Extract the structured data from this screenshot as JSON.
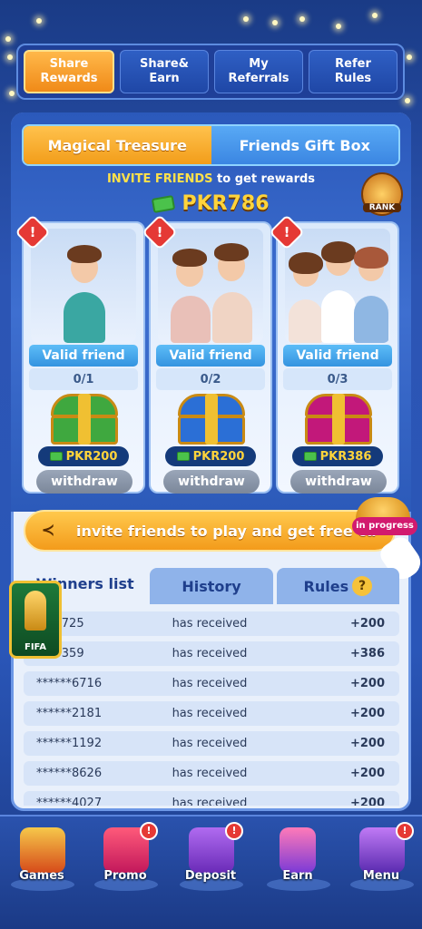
{
  "top_tabs": [
    {
      "label": "Share\nRewards",
      "active": true
    },
    {
      "label": "Share&\nEarn",
      "active": false
    },
    {
      "label": "My\nReferrals",
      "active": false
    },
    {
      "label": "Refer\nRules",
      "active": false
    }
  ],
  "segment": {
    "left_label": "Magical Treasure",
    "right_label": "Friends Gift Box"
  },
  "invite": {
    "highlight": "INVITE FRIENDS",
    "rest": " to get  rewards",
    "amount": "PKR786",
    "rank_label": "RANK"
  },
  "cards": [
    {
      "valid_label": "Valid friend",
      "progress": "0/1",
      "reward": "PKR200",
      "button": "withdraw",
      "alert": "!",
      "chest_color": "#3fa83f"
    },
    {
      "valid_label": "Valid friend",
      "progress": "0/2",
      "reward": "PKR200",
      "button": "withdraw",
      "alert": "!",
      "chest_color": "#2b6fd6"
    },
    {
      "valid_label": "Valid friend",
      "progress": "0/3",
      "reward": "PKR386",
      "button": "withdraw",
      "alert": "!",
      "chest_color": "#c2187a"
    }
  ],
  "invite_bar": {
    "text": "invite friends to play and get free ca",
    "status": "in progress"
  },
  "winners_tabs": [
    {
      "label": "Winners list",
      "active": true
    },
    {
      "label": "History",
      "active": false
    },
    {
      "label": "Rules",
      "active": false
    }
  ],
  "winners": [
    {
      "user": "***3725",
      "action": "has received",
      "amount": "+200"
    },
    {
      "user": "***6359",
      "action": "has received",
      "amount": "+386"
    },
    {
      "user": "******6716",
      "action": "has received",
      "amount": "+200"
    },
    {
      "user": "******2181",
      "action": "has received",
      "amount": "+200"
    },
    {
      "user": "******1192",
      "action": "has received",
      "amount": "+200"
    },
    {
      "user": "******8626",
      "action": "has received",
      "amount": "+200"
    },
    {
      "user": "******4027",
      "action": "has received",
      "amount": "+200"
    }
  ],
  "fifa_label": "FIFA",
  "bottom_nav": [
    {
      "label": "Games",
      "badge": ""
    },
    {
      "label": "Promo",
      "badge": "!"
    },
    {
      "label": "Deposit",
      "badge": "!"
    },
    {
      "label": "Earn",
      "badge": ""
    },
    {
      "label": "Menu",
      "badge": "!"
    }
  ],
  "colors": {
    "accent_orange": "#f29d1a",
    "accent_blue": "#3b86e2",
    "gold": "#ffd43b",
    "alert_red": "#e53935"
  }
}
